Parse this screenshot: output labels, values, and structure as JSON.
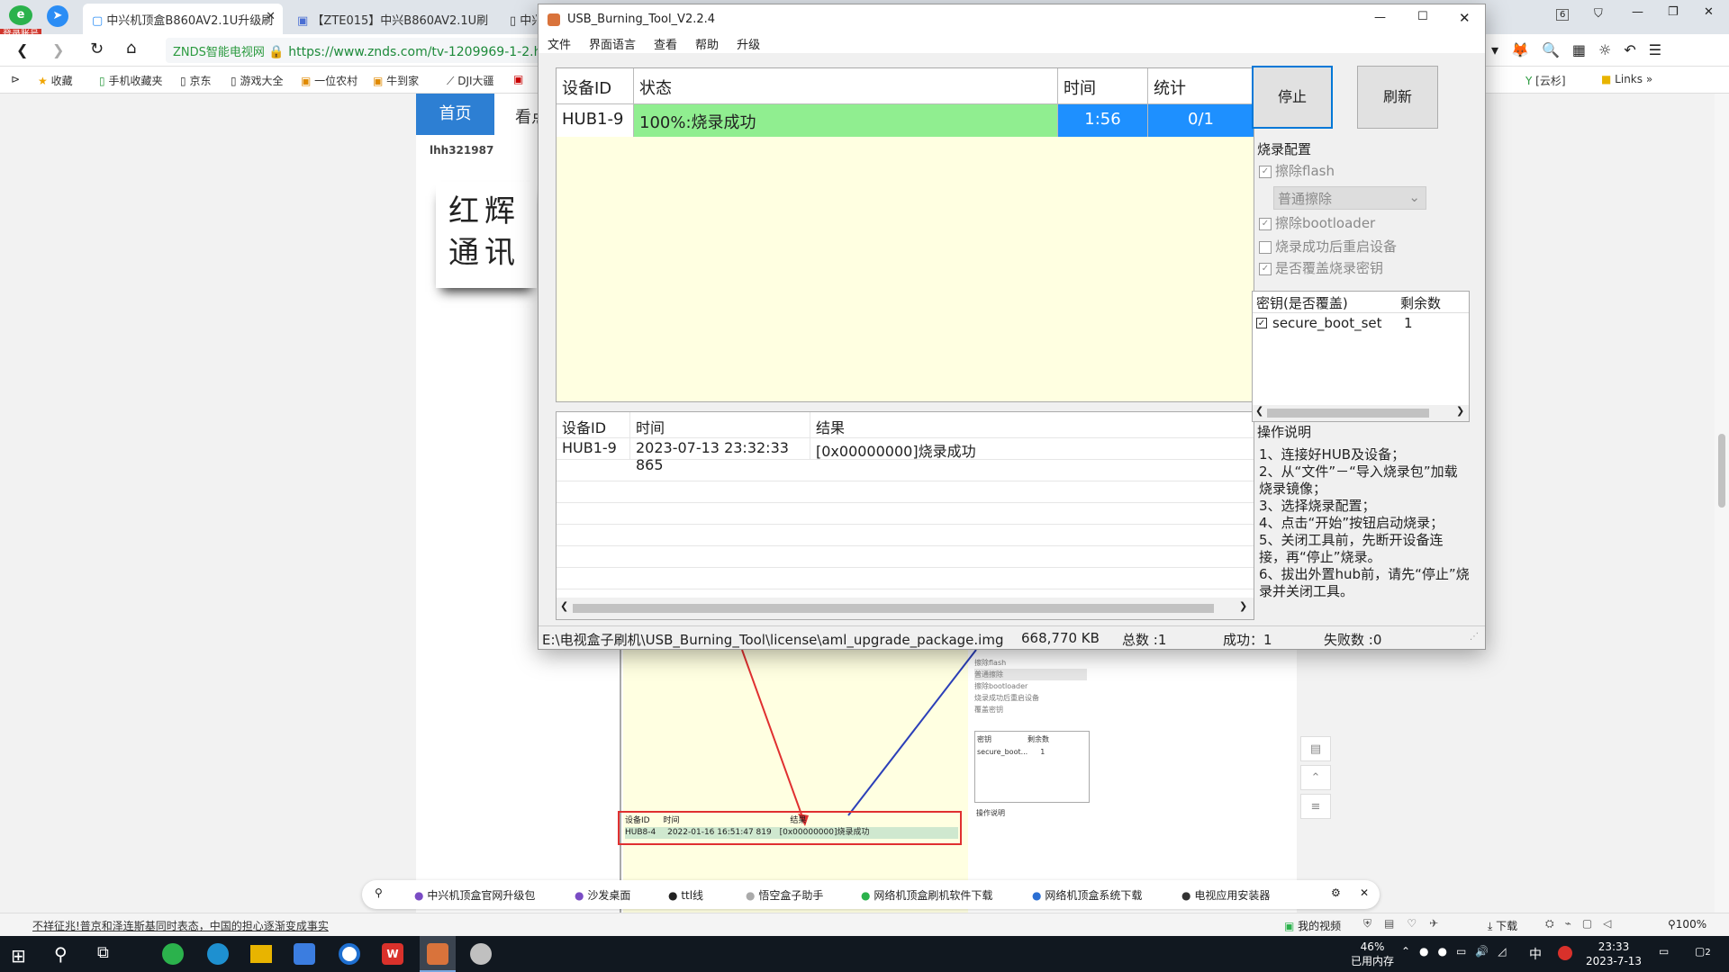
{
  "browser": {
    "badge": "登录账号",
    "tabs": [
      {
        "label": "中兴机顶盒B860AV2.1U升级刷"
      },
      {
        "label": "【ZTE015】中兴B860AV2.1U刷"
      },
      {
        "label": "中兴"
      }
    ],
    "site_name": "ZNDS智能电视网",
    "url": "https://www.znds.com/tv-1209969-1-2.h",
    "bookmarks": [
      "收藏",
      "手机收藏夹",
      "京东",
      "游戏大全",
      "一位农村",
      "牛到家",
      "DJI大疆",
      "云杉",
      "Links"
    ],
    "tab_count": "6"
  },
  "page": {
    "nav_home": "首页",
    "nav_second": "看点",
    "username": "lhh321987",
    "logo_text": "红辉通讯",
    "embedded": {
      "log_header": [
        "设备ID",
        "时间",
        "结果"
      ],
      "log_row": [
        "HUB8-4",
        "2022-01-16 16:51:47 819",
        "[0x00000000]烧录成功"
      ],
      "opts": [
        "擦除flash",
        "普通擦除",
        "擦除bootloader",
        "烧录成功后重启设备",
        "覆盖密钥"
      ],
      "key_header": [
        "密钥",
        "剩余数"
      ],
      "key_row": [
        "secure_boot...",
        "1"
      ],
      "ops_title": "操作说明"
    },
    "toolbar_items": [
      "中兴机顶盒官网升级包",
      "沙发桌面",
      "ttl线",
      "悟空盒子助手",
      "网络机顶盒刷机软件下载",
      "网络机顶盒系统下载",
      "电视应用安装器"
    ]
  },
  "app": {
    "title": "USB_Burning_Tool_V2.2.4",
    "menu": [
      "文件",
      "界面语言",
      "查看",
      "帮助",
      "升级"
    ],
    "device_table": {
      "headers": [
        "设备ID",
        "状态",
        "时间",
        "统计"
      ],
      "row": {
        "device_id": "HUB1-9",
        "status": "100%:烧录成功",
        "time": "1:56",
        "count": "0/1",
        "progress": 1.0
      }
    },
    "log_table": {
      "headers": [
        "设备ID",
        "时间",
        "结果"
      ],
      "rows": [
        [
          "HUB1-9",
          "2023-07-13 23:32:33 865",
          "[0x00000000]烧录成功"
        ]
      ]
    },
    "buttons": {
      "stop": "停止",
      "refresh": "刷新"
    },
    "config": {
      "title": "烧录配置",
      "erase_flash": "擦除flash",
      "erase_mode": "普通擦除",
      "erase_bootloader": "擦除bootloader",
      "reboot_after": "烧录成功后重启设备",
      "overwrite_key": "是否覆盖烧录密钥"
    },
    "key_table": {
      "headers": [
        "密钥(是否覆盖)",
        "剩余数"
      ],
      "rows": [
        [
          "secure_boot_set",
          "1"
        ]
      ]
    },
    "instructions": {
      "title": "操作说明",
      "lines": [
        "1、连接好HUB及设备；",
        "2、从“文件”－“导入烧录包”加载烧录镜像；",
        "3、选择烧录配置；",
        "4、点击“开始”按钮启动烧录；",
        "5、关闭工具前，先断开设备连接，再“停止”烧录。",
        "6、拔出外置hub前，请先“停止”烧录并关闭工具。"
      ]
    },
    "status": {
      "path": "E:\\电视盒子刷机\\USB_Burning_Tool\\license\\aml_upgrade_package.img",
      "size": "668,770 KB",
      "total": "总数 :1",
      "success": "成功：1",
      "failed": "失败数 :0"
    }
  },
  "statusbar": {
    "news": "不祥征兆!普京和泽连斯基同时表态，中国的担心逐渐变成事实",
    "video": "我的视频",
    "download": "下载",
    "zoom": "100%"
  },
  "taskbar": {
    "mem_pct": "46%",
    "mem_label": "已用内存",
    "ime": "中",
    "time": "23:33",
    "date": "2023-7-13",
    "notif": "2"
  },
  "colors": {
    "progress_green": "#90ee90",
    "selection_blue": "#1e90ff",
    "title_red": "#cc0000"
  }
}
